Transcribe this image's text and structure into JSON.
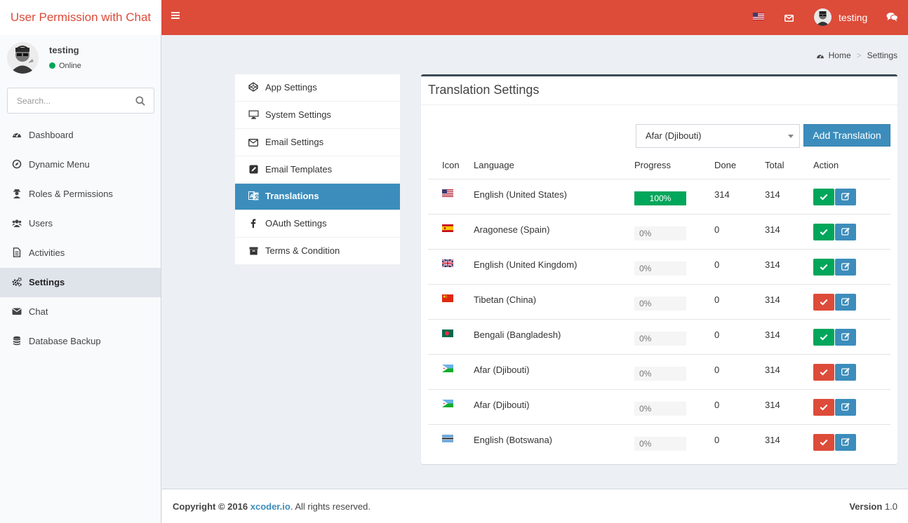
{
  "app": {
    "title": "User Permission with Chat"
  },
  "topbar": {
    "username": "testing",
    "flag_icon": "us-flag-icon",
    "mail_icon": "envelope-icon",
    "chat_icon": "comments-icon"
  },
  "user_panel": {
    "name": "testing",
    "status": "Online"
  },
  "search": {
    "placeholder": "Search..."
  },
  "sidebar": {
    "items": [
      {
        "label": "Dashboard",
        "icon": "dashboard-icon",
        "active": false
      },
      {
        "label": "Dynamic Menu",
        "icon": "compass-icon",
        "active": false
      },
      {
        "label": "Roles & Permissions",
        "icon": "user-secret-icon",
        "active": false
      },
      {
        "label": "Users",
        "icon": "users-icon",
        "active": false
      },
      {
        "label": "Activities",
        "icon": "file-text-icon",
        "active": false
      },
      {
        "label": "Settings",
        "icon": "cogs-icon",
        "active": true
      },
      {
        "label": "Chat",
        "icon": "envelope-icon",
        "active": false
      },
      {
        "label": "Database Backup",
        "icon": "database-icon",
        "active": false
      }
    ]
  },
  "breadcrumb": {
    "home": "Home",
    "current": "Settings"
  },
  "settings_menu": {
    "items": [
      {
        "label": "App Settings",
        "icon": "codepen-icon",
        "active": false
      },
      {
        "label": "System Settings",
        "icon": "desktop-icon",
        "active": false
      },
      {
        "label": "Email Settings",
        "icon": "envelope-outline-icon",
        "active": false
      },
      {
        "label": "Email Templates",
        "icon": "pencil-square-icon",
        "active": false
      },
      {
        "label": "Translations",
        "icon": "language-icon",
        "active": true
      },
      {
        "label": "OAuth Settings",
        "icon": "facebook-icon",
        "active": false
      },
      {
        "label": "Terms & Condition",
        "icon": "archive-icon",
        "active": false
      }
    ]
  },
  "translation": {
    "title": "Translation Settings",
    "selected_language": "Afar (Djibouti)",
    "add_button": "Add Translation",
    "columns": [
      "Icon",
      "Language",
      "Progress",
      "Done",
      "Total",
      "Action"
    ],
    "rows": [
      {
        "flag": "us",
        "language": "English (United States)",
        "progress": 100,
        "progress_label": "100%",
        "done": "314",
        "total": "314",
        "status": "ok"
      },
      {
        "flag": "es",
        "language": "Aragonese (Spain)",
        "progress": 0,
        "progress_label": "0%",
        "done": "0",
        "total": "314",
        "status": "ok"
      },
      {
        "flag": "gb",
        "language": "English (United Kingdom)",
        "progress": 0,
        "progress_label": "0%",
        "done": "0",
        "total": "314",
        "status": "ok"
      },
      {
        "flag": "cn",
        "language": "Tibetan (China)",
        "progress": 0,
        "progress_label": "0%",
        "done": "0",
        "total": "314",
        "status": "no"
      },
      {
        "flag": "bd",
        "language": "Bengali (Bangladesh)",
        "progress": 0,
        "progress_label": "0%",
        "done": "0",
        "total": "314",
        "status": "ok"
      },
      {
        "flag": "dj",
        "language": "Afar (Djibouti)",
        "progress": 0,
        "progress_label": "0%",
        "done": "0",
        "total": "314",
        "status": "no"
      },
      {
        "flag": "dj",
        "language": "Afar (Djibouti)",
        "progress": 0,
        "progress_label": "0%",
        "done": "0",
        "total": "314",
        "status": "no"
      },
      {
        "flag": "bw",
        "language": "English (Botswana)",
        "progress": 0,
        "progress_label": "0%",
        "done": "0",
        "total": "314",
        "status": "no"
      }
    ]
  },
  "footer": {
    "copyright_prefix": "Copyright © 2016",
    "link": "xcoder.io",
    "suffix": ". All rights reserved.",
    "version_label": "Version",
    "version": "1.0"
  },
  "colors": {
    "brand": "#dd4b39",
    "primary": "#3c8dbc",
    "success": "#00a65a",
    "danger": "#dd4b39"
  }
}
